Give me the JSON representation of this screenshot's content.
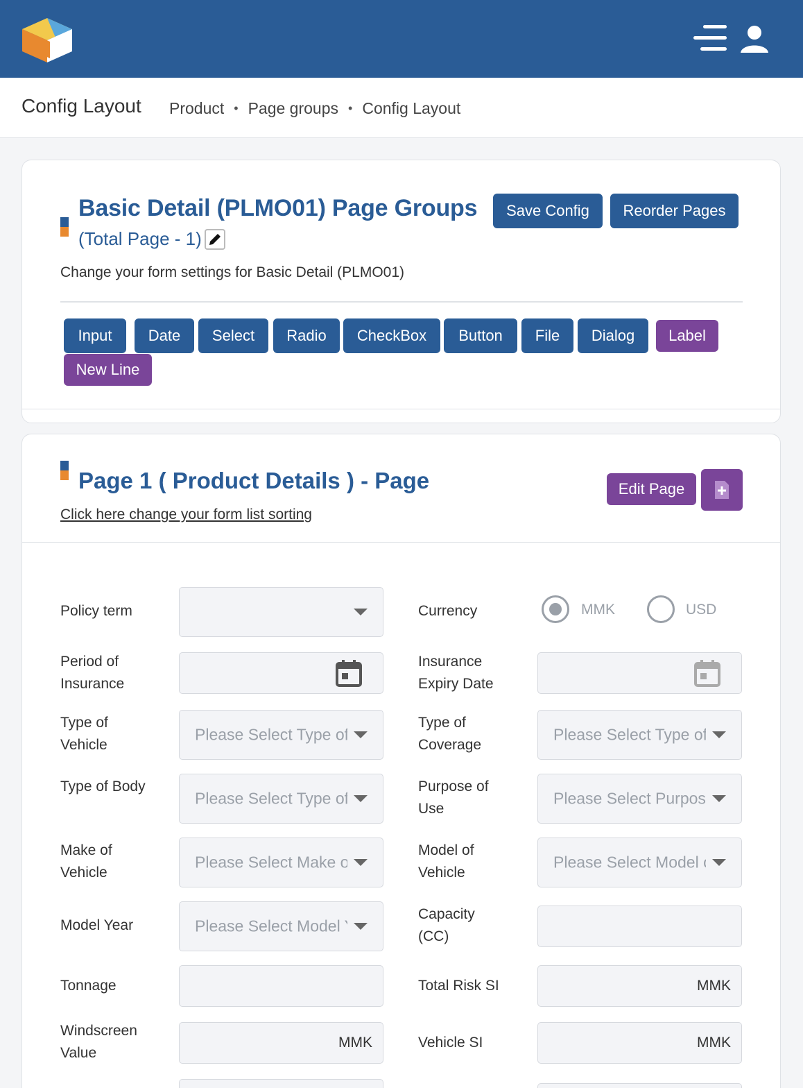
{
  "topbar": {
    "logo": "cube-logo",
    "menu_icon": "menu-icon",
    "user_icon": "user-icon"
  },
  "breadcrumb": {
    "title": "Config Layout",
    "items": [
      "Product",
      "Page groups",
      "Config Layout"
    ]
  },
  "group_card": {
    "heading": "Basic Detail (PLMO01) Page Groups",
    "subheading": "(Total Page - 1)",
    "description": "Change your form settings for Basic Detail (PLMO01)",
    "save_label": "Save Config",
    "reorder_label": "Reorder Pages",
    "element_buttons": [
      "Input",
      "Date",
      "Select",
      "Radio",
      "CheckBox",
      "Button",
      "File",
      "Dialog",
      "Label",
      "New Line"
    ]
  },
  "page_card": {
    "heading": "Page 1 ( Product Details ) - Page",
    "sort_link": "Click here change your form list sorting",
    "edit_label": "Edit Page",
    "add_icon": "add-file-icon"
  },
  "form": {
    "policy_term": {
      "label": "Policy term",
      "value": ""
    },
    "currency": {
      "label": "Currency",
      "options": [
        "MMK",
        "USD"
      ],
      "selected": "MMK"
    },
    "period_of_insurance": {
      "label": "Period of Insurance",
      "value": ""
    },
    "insurance_expiry_date": {
      "label": "Insurance Expiry Date",
      "value": ""
    },
    "type_of_vehicle": {
      "label": "Type of Vehicle",
      "placeholder": "Please Select Type of Vehicle"
    },
    "type_of_coverage": {
      "label": "Type of Coverage",
      "placeholder": "Please Select Type of Coverage"
    },
    "type_of_body": {
      "label": "Type of Body",
      "placeholder": "Please Select Type of Body"
    },
    "purpose_of_use": {
      "label": "Purpose of Use",
      "placeholder": "Please Select Purpose of Use"
    },
    "make_of_vehicle": {
      "label": "Make of Vehicle",
      "placeholder": "Please Select Make of Vehicle"
    },
    "model_of_vehicle": {
      "label": "Model of Vehicle",
      "placeholder": "Please Select Model of Vehicle"
    },
    "model_year": {
      "label": "Model Year",
      "placeholder": "Please Select Model Year"
    },
    "capacity": {
      "label": "Capacity (CC)",
      "value": ""
    },
    "tonnage": {
      "label": "Tonnage",
      "value": ""
    },
    "total_risk_si": {
      "label": "Total Risk SI",
      "unit": "MMK"
    },
    "windscreen_value": {
      "label": "Windscreen Value",
      "unit": "MMK"
    },
    "vehicle_si": {
      "label": "Vehicle SI",
      "unit": "MMK"
    }
  }
}
